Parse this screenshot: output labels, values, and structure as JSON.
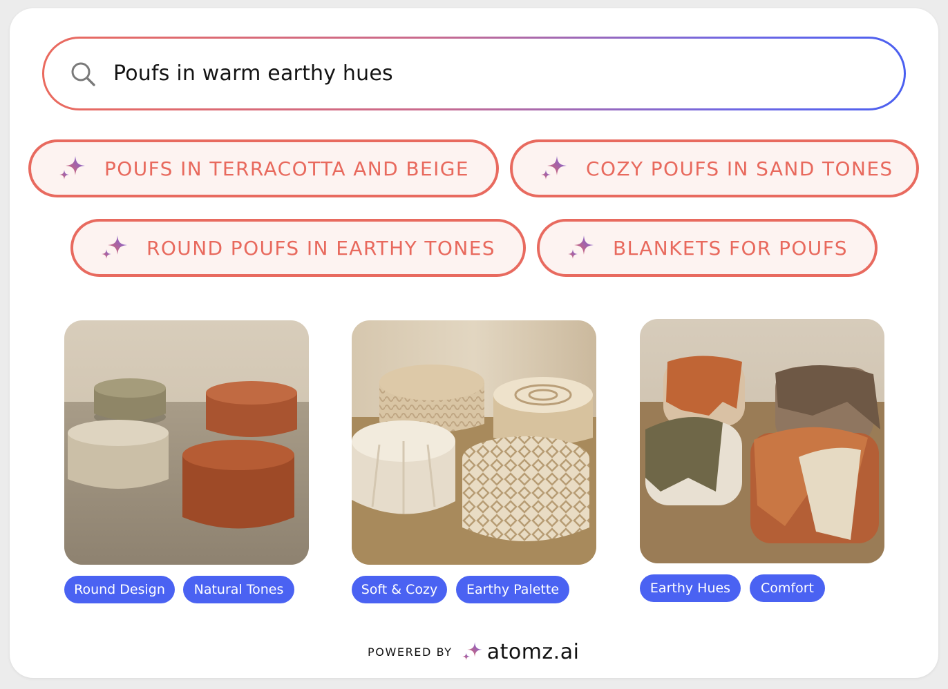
{
  "search": {
    "query": "Poufs in warm earthy hues",
    "icon": "search-icon"
  },
  "suggestions": [
    {
      "label": "POUFS IN TERRACOTTA AND BEIGE",
      "icon": "sparkle-icon"
    },
    {
      "label": "COZY POUFS IN SAND TONES",
      "icon": "sparkle-icon"
    },
    {
      "label": "ROUND POUFS IN EARTHY TONES",
      "icon": "sparkle-icon"
    },
    {
      "label": "BLANKETS FOR POUFS",
      "icon": "sparkle-icon"
    }
  ],
  "products": [
    {
      "tags": [
        "Round Design",
        "Natural Tones"
      ]
    },
    {
      "tags": [
        "Soft & Cozy",
        "Earthy Palette"
      ]
    },
    {
      "tags": [
        "Earthy Hues",
        "Comfort"
      ]
    }
  ],
  "footer": {
    "powered_by": "POWERED BY",
    "brand": "atomz.ai"
  },
  "colors": {
    "chip_border": "#e86a5f",
    "chip_text": "#e8695d",
    "tag_bg": "#4a62f2",
    "gradient_start": "#ea6a5e",
    "gradient_end": "#4a5ff0"
  }
}
